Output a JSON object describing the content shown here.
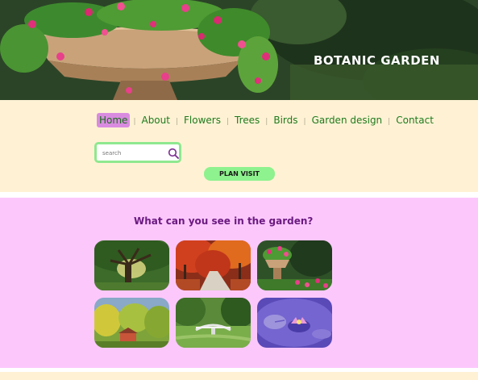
{
  "hero": {
    "title": "BOTANIC GARDEN"
  },
  "nav": {
    "items": [
      {
        "label": "Home",
        "active": true
      },
      {
        "label": "About",
        "active": false
      },
      {
        "label": "Flowers",
        "active": false
      },
      {
        "label": "Trees",
        "active": false
      },
      {
        "label": "Birds",
        "active": false
      },
      {
        "label": "Garden design",
        "active": false
      },
      {
        "label": "Contact",
        "active": false
      }
    ],
    "separator": "|"
  },
  "search": {
    "placeholder": "search",
    "icon": "search-icon"
  },
  "plan_visit": {
    "label": "PLAN VISIT"
  },
  "gallery": {
    "title": "What can you see in the garden?",
    "images": [
      {
        "subject": "tree"
      },
      {
        "subject": "autumn-path"
      },
      {
        "subject": "flower-planter"
      },
      {
        "subject": "house-in-trees"
      },
      {
        "subject": "bridge"
      },
      {
        "subject": "water-lily"
      }
    ]
  },
  "colors": {
    "nav_background": "#fff2d4",
    "gallery_background": "#fcc8fc",
    "nav_text": "#1e7a1e",
    "active_nav": "#d98be0",
    "button": "#8ef28e",
    "gallery_title": "#6b1a80"
  }
}
